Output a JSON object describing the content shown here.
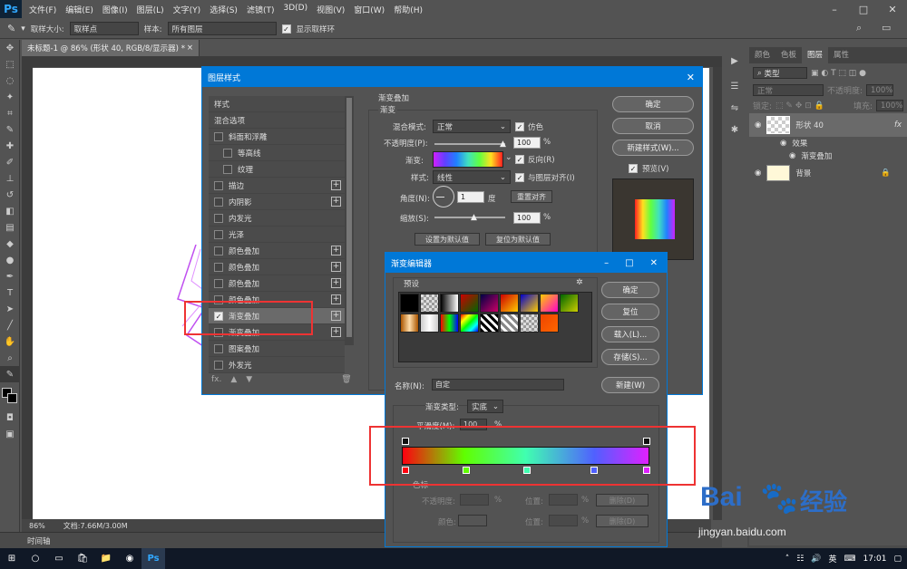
{
  "app": {
    "logo": "Ps",
    "menus": [
      "文件(F)",
      "编辑(E)",
      "图像(I)",
      "图层(L)",
      "文字(Y)",
      "选择(S)",
      "滤镜(T)",
      "3D(D)",
      "视图(V)",
      "窗口(W)",
      "帮助(H)"
    ]
  },
  "options": {
    "sample_size_label": "取样大小:",
    "sample_size": "取样点",
    "sample_label": "样本:",
    "sample": "所有图层",
    "show_ring": "显示取样环"
  },
  "doc": {
    "tab": "未标题-1 @ 86% (形状 40, RGB/8/显示器) *",
    "zoom": "86%",
    "docsize": "文档:7.66M/3.00M",
    "timeline": "时间轴"
  },
  "panel": {
    "tabs": [
      "颜色",
      "色板",
      "图层",
      "属性"
    ],
    "kind": "类型",
    "mode": "正常",
    "opacity_label": "不透明度:",
    "opacity": "100%",
    "lock_label": "锁定:",
    "fill_label": "填充:",
    "fill": "100%",
    "layers": [
      {
        "name": "形状 40",
        "fx": "fx"
      },
      {
        "name": "效果"
      },
      {
        "name": "渐变叠加"
      },
      {
        "name": "背景"
      }
    ]
  },
  "layer_style": {
    "title": "图层样式",
    "list": [
      {
        "label": "样式",
        "check": null,
        "plus": false
      },
      {
        "label": "混合选项",
        "check": null,
        "plus": false
      },
      {
        "label": "斜面和浮雕",
        "check": false,
        "plus": false
      },
      {
        "label": "等高线",
        "check": false,
        "plus": false,
        "indent": true
      },
      {
        "label": "纹理",
        "check": false,
        "plus": false,
        "indent": true
      },
      {
        "label": "描边",
        "check": false,
        "plus": true
      },
      {
        "label": "内阴影",
        "check": false,
        "plus": true
      },
      {
        "label": "内发光",
        "check": false,
        "plus": false
      },
      {
        "label": "光泽",
        "check": false,
        "plus": false
      },
      {
        "label": "颜色叠加",
        "check": false,
        "plus": true
      },
      {
        "label": "颜色叠加",
        "check": false,
        "plus": true
      },
      {
        "label": "颜色叠加",
        "check": false,
        "plus": true
      },
      {
        "label": "颜色叠加",
        "check": false,
        "plus": true
      },
      {
        "label": "渐变叠加",
        "check": true,
        "plus": true
      },
      {
        "label": "渐变叠加",
        "check": false,
        "plus": true
      },
      {
        "label": "图案叠加",
        "check": false,
        "plus": false
      },
      {
        "label": "外发光",
        "check": false,
        "plus": false
      }
    ],
    "section": "渐变叠加",
    "group": "渐变",
    "blend_label": "混合模式:",
    "blend": "正常",
    "dither": "仿色",
    "opacity_label": "不透明度(P):",
    "opacity": "100",
    "pct": "%",
    "gradient_label": "渐变:",
    "reverse": "反向(R)",
    "style_label": "样式:",
    "style": "线性",
    "align": "与图层对齐(I)",
    "angle_label": "角度(N):",
    "angle": "1",
    "deg": "度",
    "reset_align": "重置对齐",
    "scale_label": "缩放(S):",
    "scale": "100",
    "set_default": "设置为默认值",
    "reset_default": "复位为默认值",
    "ok": "确定",
    "cancel": "取消",
    "new_style": "新建样式(W)...",
    "preview": "预览(V)"
  },
  "gradient_editor": {
    "title": "渐变编辑器",
    "presets_label": "预设",
    "ok": "确定",
    "reset": "复位",
    "load": "载入(L)...",
    "save": "存储(S)...",
    "name_label": "名称(N):",
    "name": "自定",
    "new": "新建(W)",
    "type_label": "渐变类型:",
    "type": "实底",
    "smooth_label": "平滑度(M):",
    "smooth": "100",
    "pct": "%",
    "stops_label": "色标",
    "stop_opacity_label": "不透明度:",
    "stop_location_label": "位置:",
    "delete": "删除(D)",
    "stop_color_label": "颜色:",
    "stop_pct": "%"
  },
  "tray": {
    "ime": "英",
    "time": "17:01"
  },
  "watermark": {
    "brand": "Bai",
    "brand2": "经验",
    "url": "jingyan.baidu.com"
  },
  "colors": {
    "accent": "#0078d7",
    "highlight": "#e33333"
  }
}
